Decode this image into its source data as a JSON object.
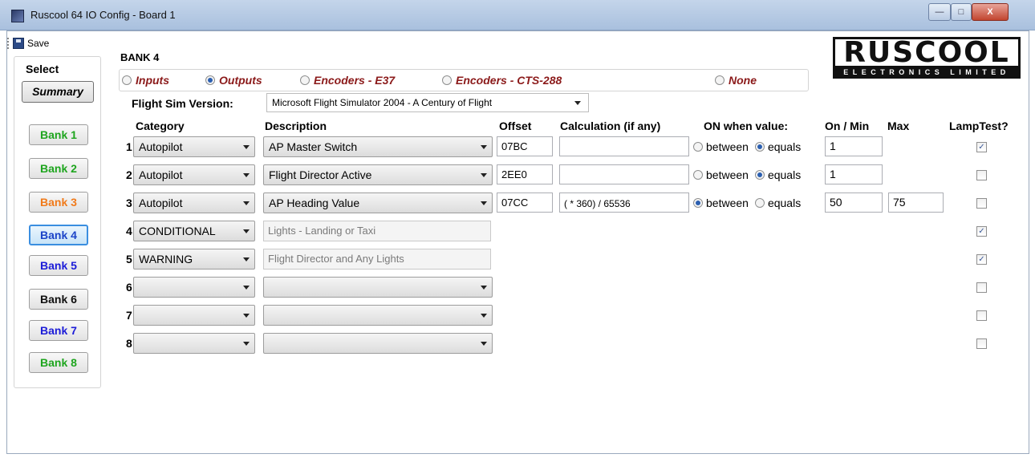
{
  "window": {
    "title": "Ruscool 64 IO Config - Board 1",
    "close_glyph": "X"
  },
  "toolbar": {
    "save_label": "Save"
  },
  "left": {
    "select_label": "Select",
    "summary_label": "Summary",
    "banks": [
      {
        "label": "Bank 1",
        "color": "#1ea51e"
      },
      {
        "label": "Bank 2",
        "color": "#1ea51e"
      },
      {
        "label": "Bank 3",
        "color": "#f07a1a"
      },
      {
        "label": "Bank 4",
        "color": "#1c44c8"
      },
      {
        "label": "Bank 5",
        "color": "#1c1cd8"
      },
      {
        "label": "Bank 6",
        "color": "#111111"
      },
      {
        "label": "Bank 7",
        "color": "#1c1cd8"
      },
      {
        "label": "Bank 8",
        "color": "#1ea51e"
      }
    ]
  },
  "main": {
    "bank_title": "BANK 4",
    "modes": [
      "Inputs",
      "Outputs",
      "Encoders - E37",
      "Encoders - CTS-288",
      "None"
    ],
    "selected_mode": "Outputs",
    "fsv_label": "Flight Sim Version:",
    "fsv_value": "Microsoft Flight Simulator 2004 - A Century of Flight",
    "headers": {
      "category": "Category",
      "description": "Description",
      "offset": "Offset",
      "calculation": "Calculation (if any)",
      "on_when": "ON when value:",
      "on_min": "On / Min",
      "max": "Max",
      "lamptest": "LampTest?"
    },
    "radio_labels": {
      "between": "between",
      "equals": "equals"
    },
    "rows": [
      {
        "num": "1",
        "category": "Autopilot",
        "description": "AP Master Switch",
        "offset": "07BC",
        "calc": "",
        "mode": "equals",
        "onmin": "1",
        "max": "",
        "lamptest": true
      },
      {
        "num": "2",
        "category": "Autopilot",
        "description": "Flight Director Active",
        "offset": "2EE0",
        "calc": "",
        "mode": "equals",
        "onmin": "1",
        "max": "",
        "lamptest": false
      },
      {
        "num": "3",
        "category": "Autopilot",
        "description": "AP Heading Value",
        "offset": "07CC",
        "calc": "( * 360) / 65536",
        "mode": "between",
        "onmin": "50",
        "max": "75",
        "lamptest": false
      },
      {
        "num": "4",
        "category": "CONDITIONAL",
        "description": "Lights - Landing or Taxi",
        "lamptest": true
      },
      {
        "num": "5",
        "category": "WARNING",
        "description": "Flight Director and Any Lights",
        "lamptest": true
      },
      {
        "num": "6",
        "category": "",
        "description": "",
        "lamptest": false
      },
      {
        "num": "7",
        "category": "",
        "description": "",
        "lamptest": false
      },
      {
        "num": "8",
        "category": "",
        "description": "",
        "lamptest": false
      }
    ]
  },
  "logo": {
    "main": "RUSCOOL",
    "sub": "ELECTRONICS LIMITED"
  }
}
